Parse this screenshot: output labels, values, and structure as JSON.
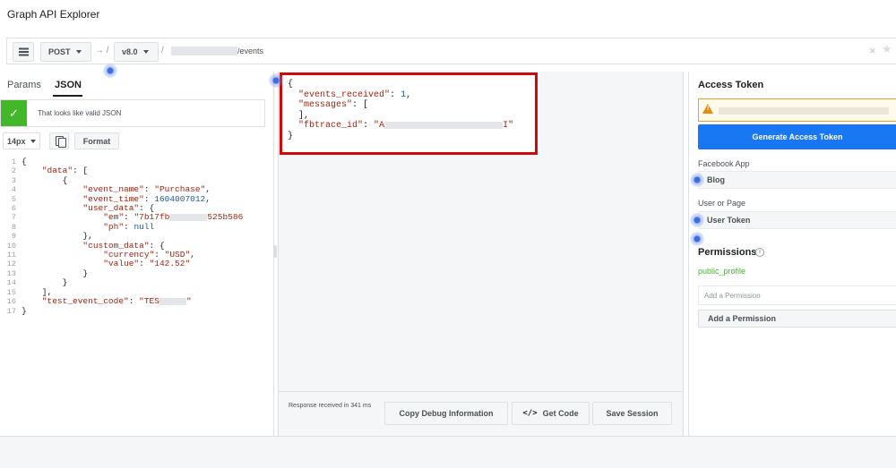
{
  "app": {
    "title": "Graph API Explorer"
  },
  "request_bar": {
    "method": "POST",
    "arrow": "→ /",
    "version": "v8.0",
    "slash": "/",
    "path_suffix": "/events",
    "clear_glyph": "×",
    "star_glyph": "★"
  },
  "left_panel": {
    "tabs": [
      {
        "label": "Params"
      },
      {
        "label": "JSON",
        "active": true
      }
    ],
    "validation": {
      "check_glyph": "✓",
      "text": "That looks like valid JSON",
      "color": "#42b72a"
    },
    "toolbar": {
      "font_size": "14px",
      "format_label": "Format"
    },
    "editor": {
      "line_numbers": [
        "1",
        "2",
        "3",
        "4",
        "5",
        "6",
        "7",
        "8",
        "9",
        "10",
        "11",
        "12",
        "13",
        "14",
        "15",
        "16",
        "17"
      ],
      "json": {
        "event_name": "Purchase",
        "event_time": "1604007012",
        "em_prefix": "\"7b17fb",
        "em_suffix": "525b586",
        "ph": "null",
        "currency": "\"USD\"",
        "value": "\"142.52\"",
        "test_event_code_prefix": "\"TES",
        "test_event_code_suffix": "\""
      }
    }
  },
  "response": {
    "events_received": "1",
    "fbtrace_prefix": "\"A",
    "fbtrace_suffix": "I\"",
    "border_color": "#cc0a0a",
    "footer": {
      "time_text": "Response received in 341 ms",
      "debug_label": "Copy Debug Information",
      "getcode_icon": "</>",
      "getcode_label": "Get Code",
      "session_label": "Save Session"
    }
  },
  "right_panel": {
    "access_token_heading": "Access Token",
    "generate_label": "Generate Access Token",
    "facebook_app_label": "Facebook App",
    "facebook_app_value": "Blog",
    "user_or_page_label": "User or Page",
    "user_or_page_value": "User Token",
    "permissions_heading": "Permissions",
    "info_glyph": "i",
    "permission_item": "public_profile",
    "add_permission_placeholder": "Add a Permission",
    "add_permission_button": "Add a Permission",
    "accent_color": "#1877f2"
  }
}
